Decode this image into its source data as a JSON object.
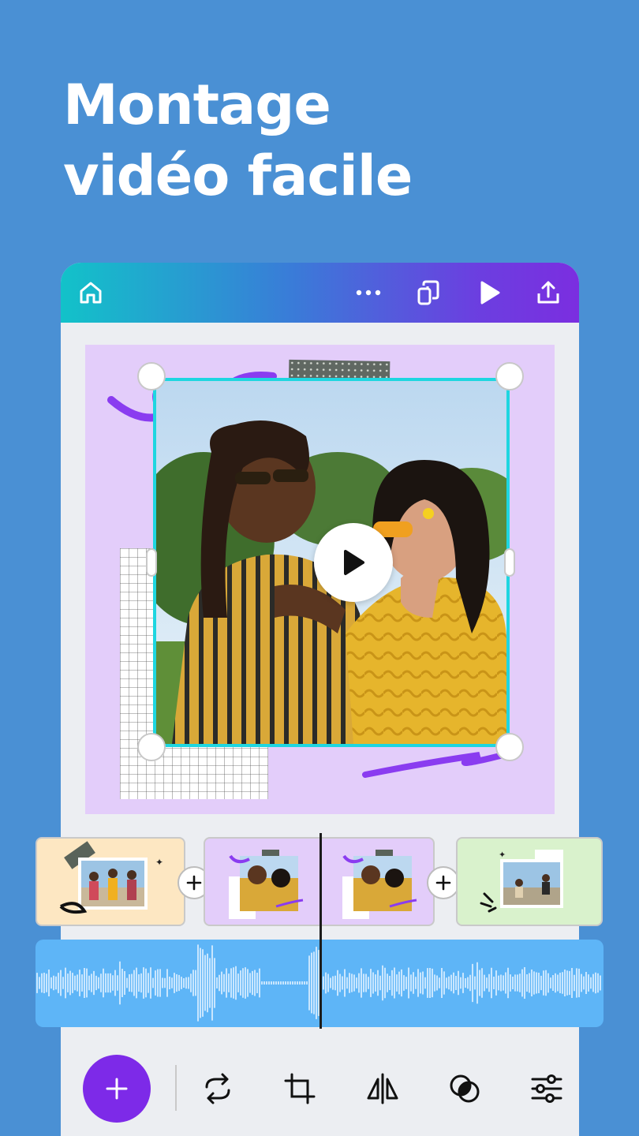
{
  "headline": {
    "line1": "Montage",
    "line2": "vidéo facile"
  },
  "topbar": {
    "icons": [
      "home-icon",
      "more-icon",
      "pages-icon",
      "play-icon",
      "share-icon"
    ]
  },
  "timeline": {
    "clips": [
      {
        "name": "clip-1",
        "bg": "#fde7c2"
      },
      {
        "name": "clip-2",
        "bg": "#e3cdfa"
      },
      {
        "name": "clip-3",
        "bg": "#d9f2cc"
      }
    ]
  },
  "toolbar": {
    "tools": [
      "add",
      "replace",
      "crop",
      "flip",
      "effects",
      "adjust"
    ]
  },
  "colors": {
    "background": "#4a90d4",
    "accent": "#7d2ae8",
    "selection": "#1ed6e0",
    "audio": "#5eb5f7"
  }
}
